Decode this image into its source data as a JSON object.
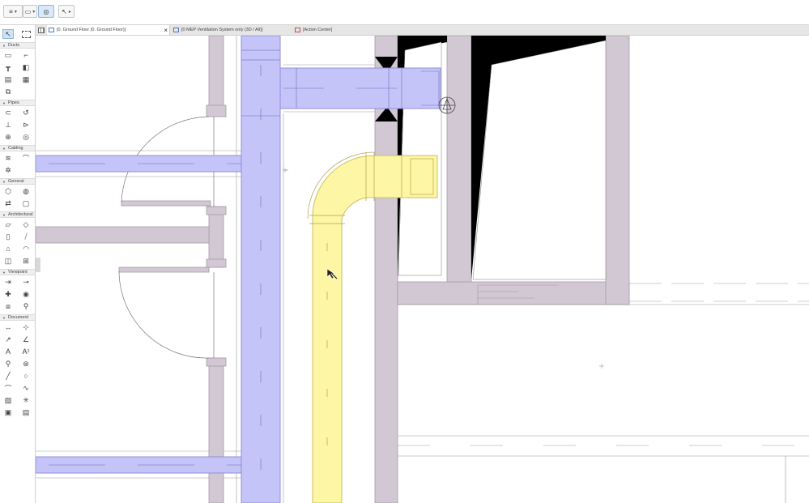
{
  "toolbar": {
    "layer_btn": "≡",
    "view_btn": "▭",
    "nav_btn": "◎",
    "cursor_btn": "↖"
  },
  "tabs": [
    {
      "label": "[0. Ground Floor (0. Ground Floor)]",
      "icon": "floor-plan-icon",
      "close": "×"
    },
    {
      "label": "[0 MEP Ventilation System only (3D / All)]",
      "icon": "3d-view-icon"
    },
    {
      "label": "[Action Center]",
      "icon": "action-center-icon"
    }
  ],
  "toolbox": {
    "sections": [
      {
        "label": "Ducts",
        "tools": [
          "duct-straight-icon",
          "duct-bend-icon",
          "duct-tee-icon",
          "duct-transition-icon",
          "duct-fitting-icon",
          "duct-terminal-icon",
          "duct-equipment-icon"
        ]
      },
      {
        "label": "Pipes",
        "tools": [
          "pipe-straight-icon",
          "pipe-bend-icon",
          "pipe-tee-icon",
          "pipe-transition-icon",
          "pipe-fitting-icon",
          "pipe-terminal-icon"
        ]
      },
      {
        "label": "Cabling",
        "tools": [
          "cable-carrier-icon",
          "cable-bend-icon",
          "cable-fitting-icon"
        ]
      },
      {
        "label": "General",
        "tools": [
          "equipment-icon",
          "flexible-segment-icon",
          "routing-icon",
          "panel-icon"
        ]
      },
      {
        "label": "Architectural",
        "tools": [
          "wall-icon",
          "slab-icon",
          "column-icon",
          "beam-icon",
          "roof-icon",
          "shell-icon",
          "door-icon",
          "window-icon"
        ]
      },
      {
        "label": "Viewpoint",
        "tools": [
          "section-icon",
          "elevation-icon",
          "interior-elevation-icon",
          "worksheet-icon",
          "detail-icon",
          "camera-icon"
        ]
      },
      {
        "label": "Document",
        "tools": [
          "dimension-icon",
          "level-dimension-icon",
          "radial-dimension-icon",
          "angle-dimension-icon",
          "text-icon",
          "label-icon",
          "marker-icon",
          "change-icon",
          "line-icon",
          "circle-icon",
          "polyline-icon",
          "spline-icon",
          "fill-icon",
          "hotspot-icon",
          "figure-icon",
          "drawing-icon"
        ]
      }
    ]
  },
  "colors": {
    "duct": "#c4c4f8",
    "duct_stroke": "#8f8fd8",
    "pipe": "#fdf6a4",
    "pipe_stroke": "#cdbf62",
    "wall": "#d2c8d3",
    "wall_stroke": "#a699a8",
    "cut": "#000000",
    "accent": "#4a78c8"
  }
}
